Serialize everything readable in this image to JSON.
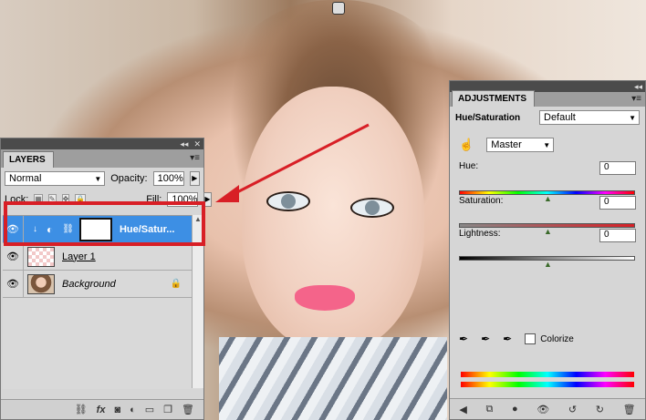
{
  "layers_panel": {
    "tab": "LAYERS",
    "blend_mode": "Normal",
    "opacity_label": "Opacity:",
    "opacity_value": "100%",
    "lock_label": "Lock:",
    "fill_label": "Fill:",
    "fill_value": "100%",
    "layers": [
      {
        "name": "Hue/Satur...",
        "selected": true
      },
      {
        "name": "Layer 1",
        "selected": false
      },
      {
        "name": "Background",
        "selected": false
      }
    ],
    "bottom_icons": [
      "link-icon",
      "fx-icon",
      "mask-icon",
      "adjustment-icon",
      "folder-icon",
      "new-layer-icon",
      "trash-icon"
    ],
    "fx_label": "fx"
  },
  "adjustments_panel": {
    "tab": "ADJUSTMENTS",
    "title": "Hue/Saturation",
    "preset": "Default",
    "channel": "Master",
    "hue_label": "Hue:",
    "hue_value": "0",
    "saturation_label": "Saturation:",
    "saturation_value": "0",
    "lightness_label": "Lightness:",
    "lightness_value": "0",
    "colorize_label": "Colorize",
    "colorize_checked": false
  },
  "colors": {
    "selection_blue": "#3d8fe4",
    "highlight_red": "#d81f26",
    "panel_gray": "#d6d6d6"
  }
}
